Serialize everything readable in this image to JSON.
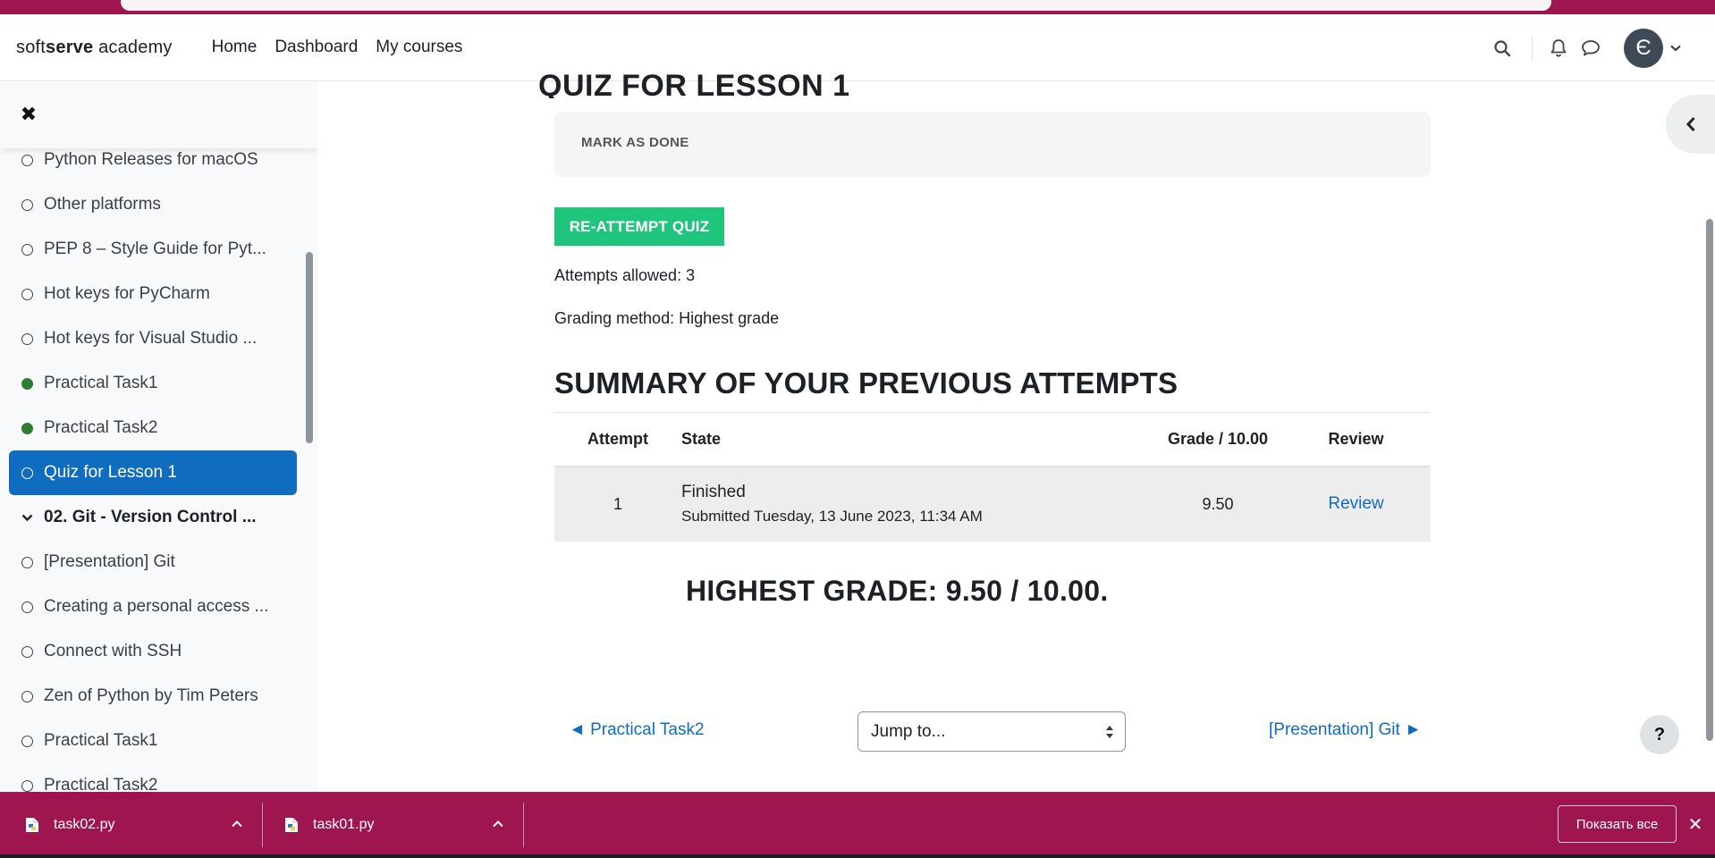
{
  "navbar": {
    "brand_prefix": "soft",
    "brand_bold": "serve",
    "brand_suffix": " academy",
    "links": [
      "Home",
      "Dashboard",
      "My courses"
    ],
    "avatar_letter": "Є"
  },
  "drawer": {
    "items": [
      {
        "label": "Python Releases for macOS",
        "type": "item",
        "done": false
      },
      {
        "label": "Other platforms",
        "type": "item",
        "done": false
      },
      {
        "label": "PEP 8 – Style Guide for Pyt...",
        "type": "item",
        "done": false
      },
      {
        "label": "Hot keys for PyCharm",
        "type": "item",
        "done": false
      },
      {
        "label": "Hot keys for Visual Studio ...",
        "type": "item",
        "done": false
      },
      {
        "label": "Practical Task1",
        "type": "item",
        "done": true
      },
      {
        "label": "Practical Task2",
        "type": "item",
        "done": true
      },
      {
        "label": "Quiz for Lesson 1",
        "type": "active",
        "done": false
      },
      {
        "label": "02. Git - Version Control ...",
        "type": "section",
        "done": false
      },
      {
        "label": "[Presentation] Git",
        "type": "item",
        "done": false
      },
      {
        "label": "Creating a personal access ...",
        "type": "item",
        "done": false
      },
      {
        "label": "Connect with SSH",
        "type": "item",
        "done": false
      },
      {
        "label": "Zen of Python by Tim Peters",
        "type": "item",
        "done": false
      },
      {
        "label": "Practical Task1",
        "type": "item",
        "done": false
      },
      {
        "label": "Practical Task2",
        "type": "item",
        "done": false
      }
    ]
  },
  "main": {
    "heading": "QUIZ FOR LESSON 1",
    "mark_done": "MARK AS DONE",
    "reattempt": "RE-ATTEMPT QUIZ",
    "attempts_allowed": "Attempts allowed: 3",
    "grading_method": "Grading method: Highest grade",
    "summary_title": "SUMMARY OF YOUR PREVIOUS ATTEMPTS",
    "table": {
      "headers": [
        "Attempt",
        "State",
        "Grade / 10.00",
        "Review"
      ],
      "rows": [
        {
          "attempt": "1",
          "state": "Finished",
          "submitted": "Submitted Tuesday, 13 June 2023, 11:34 AM",
          "grade": "9.50",
          "review": "Review"
        }
      ]
    },
    "highest_grade": "HIGHEST GRADE: 9.50 / 10.00.",
    "prev_link": "◄ Practical Task2",
    "jump_placeholder": "Jump to...",
    "next_link": "[Presentation] Git ►",
    "help": "?"
  },
  "downloads": {
    "files": [
      "task02.py",
      "task01.py"
    ],
    "show_all": "Показать все"
  },
  "colors": {
    "accent": "#0f6cbf",
    "reattempt_green": "#1fc47d",
    "download_bar": "#9e1550",
    "done_dot": "#2e7d32"
  }
}
